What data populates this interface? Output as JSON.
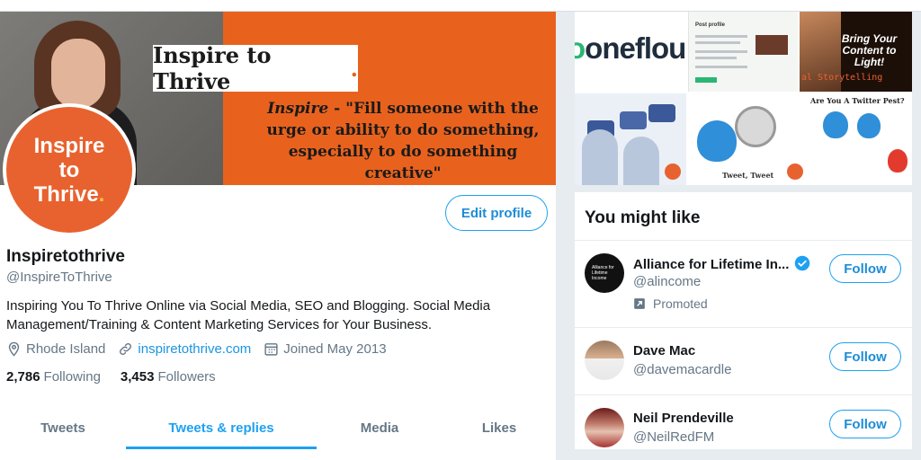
{
  "banner": {
    "title": "Inspire to Thrive",
    "title_dot": ".",
    "quote_word": "Inspire",
    "quote_dash": " - ",
    "quote_text": "\"Fill someone with the urge or ability to do something, especially to do something creative\""
  },
  "avatar": {
    "line1": "Inspire",
    "line2": "to",
    "line3": "Thrive",
    "dot": "."
  },
  "profile": {
    "edit_label": "Edit profile",
    "name": "Inspiretothrive",
    "handle": "@InspireToThrive",
    "bio": "Inspiring You To Thrive Online via Social Media, SEO and Blogging.   Social Media Management/Training & Content Marketing Services for Your Business.",
    "location": "Rhode Island",
    "website": "inspiretothrive.com",
    "joined": "Joined May 2013",
    "following_count": "2,786",
    "following_label": "Following",
    "followers_count": "3,453",
    "followers_label": "Followers"
  },
  "tabs": [
    {
      "label": "Tweets",
      "active": false
    },
    {
      "label": "Tweets & replies",
      "active": true
    },
    {
      "label": "Media",
      "active": false
    },
    {
      "label": "Likes",
      "active": false
    }
  ],
  "gallery": {
    "logo_text": "oneflou",
    "bring_text": "Bring Your Content to Light!",
    "storytelling_text": "al Storytelling",
    "post_profile_text": "Post profile",
    "tweet_tweet_text": "Tweet, Tweet",
    "twitter_pest_text": "Are You A Twitter Pest?"
  },
  "who_to_follow": {
    "title": "You might like",
    "suggestions": [
      {
        "name": "Alliance for Lifetime In...",
        "handle": "@alincome",
        "promoted": "Promoted",
        "verified": true,
        "avatar_text": "Alliance for Lifetime Income",
        "button": "Follow"
      },
      {
        "name": "Dave Mac",
        "handle": "@davemacardle",
        "button": "Follow"
      },
      {
        "name": "Neil Prendeville",
        "handle": "@NeilRedFM",
        "button": "Follow"
      }
    ]
  },
  "colors": {
    "accent": "#1da1f2",
    "brand_orange": "#e8621e",
    "muted_text": "#657786"
  },
  "icons": [
    "location-pin-icon",
    "link-icon",
    "calendar-icon",
    "verified-badge-icon",
    "promoted-arrow-icon"
  ]
}
